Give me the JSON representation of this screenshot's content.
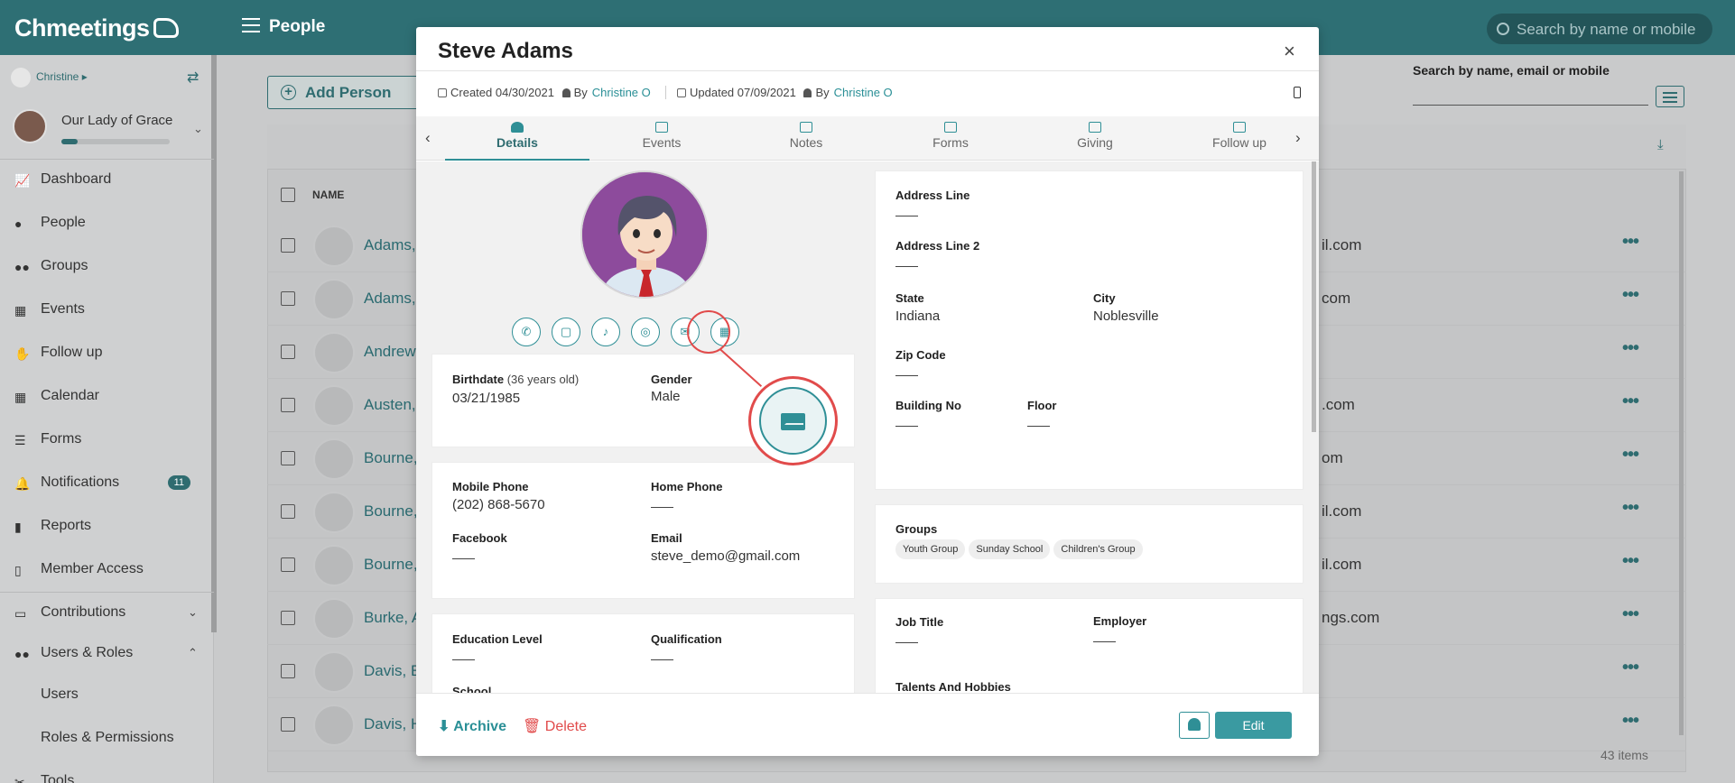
{
  "app": {
    "logo": "Chmeetings",
    "page_title": "People",
    "search_placeholder": "Search by name or mobile"
  },
  "sidebar": {
    "user": "Christine",
    "church": "Our Lady of Grace",
    "church_progress": 0.15,
    "items": [
      {
        "label": "Dashboard",
        "icon": "chart-line-icon"
      },
      {
        "label": "People",
        "icon": "person-icon"
      },
      {
        "label": "Groups",
        "icon": "users-icon"
      },
      {
        "label": "Events",
        "icon": "calendar-icon"
      },
      {
        "label": "Follow up",
        "icon": "handshake-icon"
      },
      {
        "label": "Calendar",
        "icon": "calendar-grid-icon"
      },
      {
        "label": "Forms",
        "icon": "list-icon"
      },
      {
        "label": "Notifications",
        "icon": "bell-icon",
        "badge": "11"
      },
      {
        "label": "Reports",
        "icon": "bar-chart-icon"
      },
      {
        "label": "Member Access",
        "icon": "mobile-icon"
      },
      {
        "label": "Contributions",
        "icon": "money-icon"
      },
      {
        "label": "Users & Roles",
        "icon": "users-cog-icon"
      },
      {
        "label": "Users",
        "icon": ""
      },
      {
        "label": "Roles & Permissions",
        "icon": ""
      },
      {
        "label": "Tools",
        "icon": "tools-icon"
      }
    ]
  },
  "people": {
    "add_label": "Add Person",
    "search_label": "Search by name, email or mobile",
    "column_name": "NAME",
    "items_count": "43 items",
    "rows": [
      {
        "name": "Adams,",
        "email": "il.com"
      },
      {
        "name": "Adams,",
        "email": "com"
      },
      {
        "name": "Andrews",
        "email": ""
      },
      {
        "name": "Austen,",
        "email": ".com"
      },
      {
        "name": "Bourne,",
        "email": "om"
      },
      {
        "name": "Bourne,",
        "email": "il.com"
      },
      {
        "name": "Bourne,",
        "email": "il.com"
      },
      {
        "name": "Burke, A",
        "email": "ngs.com"
      },
      {
        "name": "Davis, E",
        "email": ""
      },
      {
        "name": "Davis, H",
        "email": ""
      }
    ]
  },
  "modal": {
    "title": "Steve Adams",
    "close": "×",
    "meta": {
      "created": "Created 04/30/2021",
      "created_by_prefix": "By",
      "created_by": "Christine O",
      "updated": "Updated 07/09/2021",
      "updated_by_prefix": "By",
      "updated_by": "Christine O"
    },
    "tabs": [
      "Details",
      "Events",
      "Notes",
      "Forms",
      "Giving",
      "Follow up"
    ],
    "contact_actions": [
      "phone-icon",
      "chat-icon",
      "bell-icon",
      "whatsapp-icon",
      "email-icon",
      "qr-code-icon"
    ],
    "birth": {
      "label": "Birthdate",
      "age": "(36 years old)",
      "value": "03/21/1985",
      "gender_label": "Gender",
      "gender": "Male"
    },
    "contact": {
      "mobile_label": "Mobile Phone",
      "mobile": "(202) 868-5670",
      "home_label": "Home Phone",
      "facebook_label": "Facebook",
      "email_label": "Email",
      "email": "steve_demo@gmail.com"
    },
    "education": {
      "level_label": "Education Level",
      "qual_label": "Qualification",
      "school_label": "School"
    },
    "address": {
      "line1_label": "Address Line",
      "line2_label": "Address Line 2",
      "state_label": "State",
      "state": "Indiana",
      "city_label": "City",
      "city": "Noblesville",
      "zip_label": "Zip Code",
      "building_label": "Building No",
      "floor_label": "Floor"
    },
    "groups": {
      "label": "Groups",
      "chips": [
        "Youth Group",
        "Sunday School",
        "Children's Group"
      ]
    },
    "job": {
      "title_label": "Job Title",
      "employer_label": "Employer",
      "talents_label": "Talents And Hobbies"
    },
    "footer": {
      "archive": "Archive",
      "delete": "Delete",
      "edit": "Edit"
    }
  },
  "colors": {
    "brand": "#2f6c70",
    "accent": "#2f8f96",
    "danger": "#e14b4b"
  }
}
